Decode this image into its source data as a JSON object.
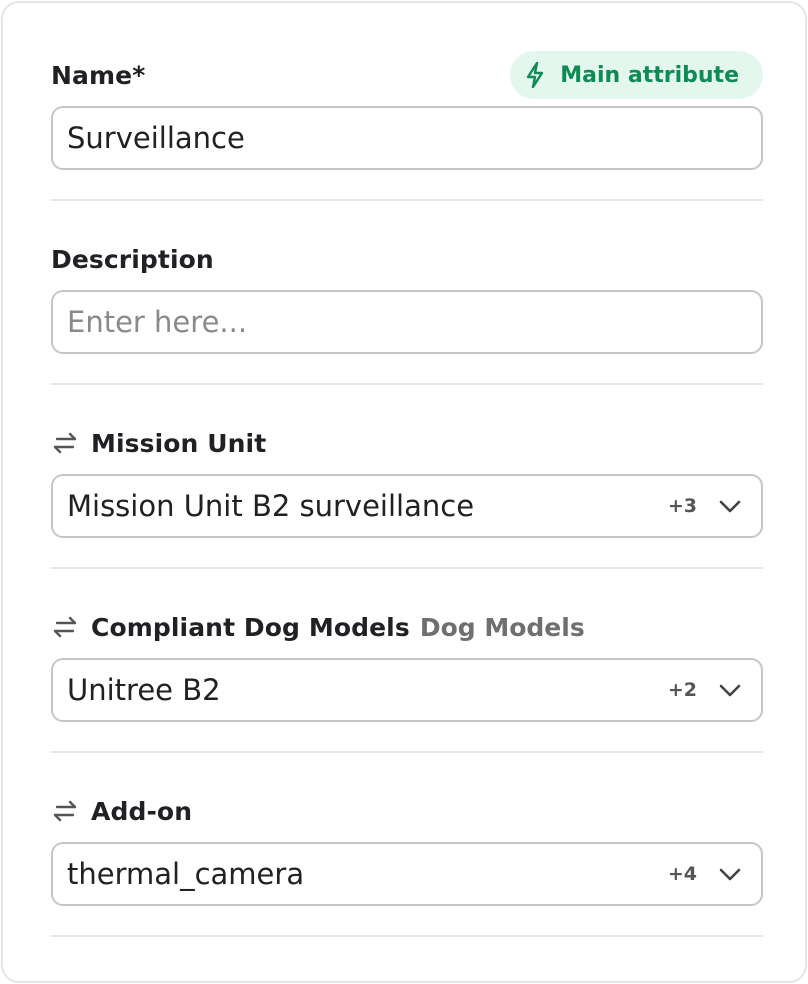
{
  "name_field": {
    "label": "Name*",
    "badge": "Main attribute",
    "value": "Surveillance"
  },
  "description_field": {
    "label": "Description",
    "value": "",
    "placeholder": "Enter here..."
  },
  "mission_unit": {
    "label": "Mission Unit",
    "value": "Mission Unit B2 surveillance",
    "count": "+3"
  },
  "compliant_dog_models": {
    "label": "Compliant Dog Models",
    "sublabel": "Dog Models",
    "value": "Unitree B2",
    "count": "+2"
  },
  "add_on": {
    "label": "Add-on",
    "value": "thermal_camera",
    "count": "+4"
  },
  "icons": {
    "relation": "arrows-left-right-icon",
    "badge": "lightning-bolt-icon",
    "dropdown": "chevron-down-icon"
  },
  "colors": {
    "badge_bg": "#e3f7ee",
    "badge_text": "#0e8a54",
    "border": "#c6c6c6",
    "divider": "#e6e6e6"
  }
}
